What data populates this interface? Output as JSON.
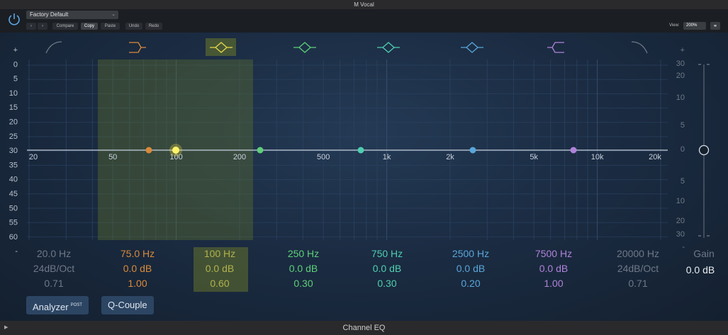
{
  "window": {
    "title": "M Vocal",
    "footer": "Channel EQ"
  },
  "header": {
    "preset": "Factory Default",
    "buttons": {
      "prev": "‹",
      "next": "›",
      "compare": "Compare",
      "copy": "Copy",
      "paste": "Paste",
      "undo": "Undo",
      "redo": "Redo"
    },
    "view_label": "View:",
    "view_value": "200%"
  },
  "graph": {
    "left_scale": [
      "+",
      "0",
      "5",
      "10",
      "15",
      "20",
      "25",
      "30",
      "35",
      "40",
      "45",
      "50",
      "55",
      "60",
      "-"
    ],
    "right_scale": [
      "+",
      "30",
      "20",
      "10",
      "5",
      "0",
      "5",
      "10",
      "20",
      "30",
      "-"
    ],
    "freq_ticks": [
      "20",
      "50",
      "100",
      "200",
      "500",
      "1k",
      "2k",
      "5k",
      "10k",
      "20k"
    ]
  },
  "bands": [
    {
      "freq": "20.0 Hz",
      "gain": "24dB/Oct",
      "q": "0.71",
      "color": "#6e7888"
    },
    {
      "freq": "75.0 Hz",
      "gain": "0.0 dB",
      "q": "1.00",
      "color": "#d98a3a"
    },
    {
      "freq": "100 Hz",
      "gain": "0.0 dB",
      "q": "0.60",
      "color": "#e8d84a"
    },
    {
      "freq": "250 Hz",
      "gain": "0.0 dB",
      "q": "0.30",
      "color": "#5fcf7a"
    },
    {
      "freq": "750 Hz",
      "gain": "0.0 dB",
      "q": "0.30",
      "color": "#4fcfb0"
    },
    {
      "freq": "2500 Hz",
      "gain": "0.0 dB",
      "q": "0.20",
      "color": "#5aa6d9"
    },
    {
      "freq": "7500 Hz",
      "gain": "0.0 dB",
      "q": "1.00",
      "color": "#b083d9"
    },
    {
      "freq": "20000 Hz",
      "gain": "24dB/Oct",
      "q": "0.71",
      "color": "#6e7888"
    }
  ],
  "gain": {
    "label": "Gain",
    "value": "0.0 dB"
  },
  "footer_buttons": {
    "analyzer": "Analyzer",
    "analyzer_badge": "POST",
    "qcouple": "Q-Couple"
  }
}
